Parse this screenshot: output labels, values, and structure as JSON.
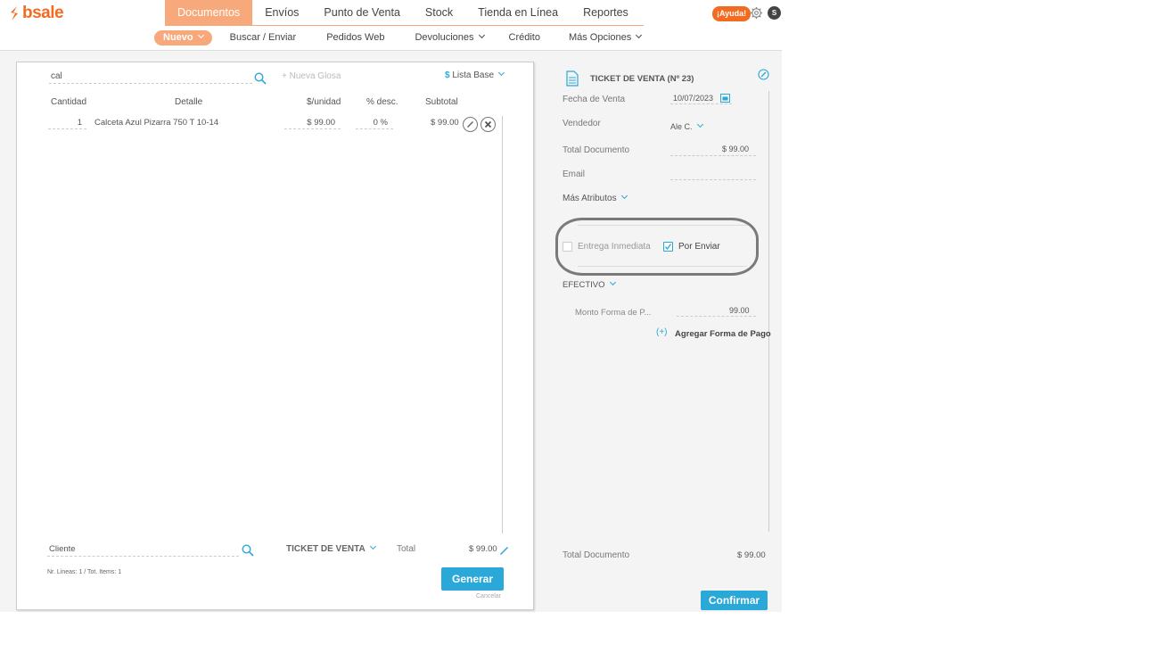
{
  "brand": {
    "name": "bsale",
    "color": "#f26b21"
  },
  "nav": {
    "items": [
      {
        "label": "Documentos",
        "active": true
      },
      {
        "label": "Envíos"
      },
      {
        "label": "Punto de Venta"
      },
      {
        "label": "Stock"
      },
      {
        "label": "Tienda en Línea"
      },
      {
        "label": "Reportes"
      }
    ],
    "sub": [
      {
        "label": "Nuevo",
        "active": true,
        "dropdown": true
      },
      {
        "label": "Buscar / Enviar"
      },
      {
        "label": "Pedidos Web"
      },
      {
        "label": "Devoluciones",
        "dropdown": true
      },
      {
        "label": "Crédito"
      },
      {
        "label": "Más Opciones",
        "dropdown": true
      }
    ],
    "help_label": "¡Ayuda!",
    "avatar_initial": "S"
  },
  "left": {
    "search_value": "cal",
    "nueva_glosa": "+ Nueva Glosa",
    "lista_symbol": "$",
    "lista_label": "Lista Base",
    "headers": {
      "cantidad": "Cantidad",
      "detalle": "Detalle",
      "unidad": "$/unidad",
      "desc": "% desc.",
      "subtotal": "Subtotal"
    },
    "row": {
      "cantidad": "1",
      "detalle": "Calceta Azul Pizarra 750 T 10-14",
      "unidad": "$ 99.00",
      "desc": "0 %",
      "subtotal": "$ 99.00"
    },
    "cliente_placeholder": "Cliente",
    "doc_type": "TICKET DE VENTA",
    "total_label": "Total",
    "total_value": "$ 99.00",
    "nr_lineas": "Nr. Lineas: 1 / Tot. Items: 1",
    "generar": "Generar",
    "cancelar": "Cancelar"
  },
  "right": {
    "doc_title": "TICKET DE VENTA (Nº 23)",
    "fecha_label": "Fecha de Venta",
    "fecha_value": "10/07/2023",
    "vendedor_label": "Vendedor",
    "vendedor_value": "Ale C.",
    "total_doc_label": "Total Documento",
    "total_doc_value": "$ 99.00",
    "email_label": "Email",
    "mas_atributos": "Más Atributos",
    "entrega_inmediata": "Entrega Inmediata",
    "entrega_checked": false,
    "por_enviar": "Por Enviar",
    "por_enviar_checked": true,
    "forma_pago": "EFECTIVO",
    "monto_label": "Monto Forma de P...",
    "monto_value": "99.00",
    "agregar_forma": "Agregar Forma de Pago",
    "footer_total_label": "Total Documento",
    "footer_total_value": "$ 99.00",
    "confirmar": "Confirmar"
  },
  "colors": {
    "accent": "#2aa8d8",
    "nav_active": "#f8a97c",
    "brand": "#f26b21"
  }
}
